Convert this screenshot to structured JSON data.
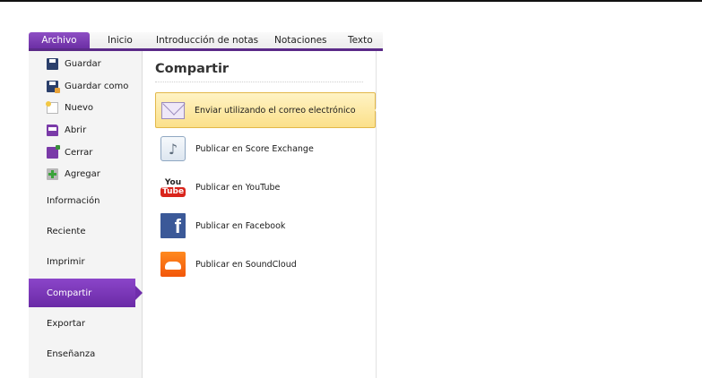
{
  "ribbon": {
    "tabs": [
      {
        "label": "Archivo",
        "active": true
      },
      {
        "label": "Inicio",
        "active": false
      },
      {
        "label": "Introducción de notas",
        "active": false
      },
      {
        "label": "Notaciones",
        "active": false
      },
      {
        "label": "Texto",
        "active": false
      }
    ],
    "accent_color": "#6a2da3"
  },
  "backstage": {
    "commands": [
      {
        "label": "Guardar",
        "icon": "save-icon"
      },
      {
        "label": "Guardar como",
        "icon": "save-as-icon"
      },
      {
        "label": "Nuevo",
        "icon": "new-document-icon"
      },
      {
        "label": "Abrir",
        "icon": "open-folder-icon"
      },
      {
        "label": "Cerrar",
        "icon": "close-folder-icon"
      },
      {
        "label": "Agregar",
        "icon": "add-icon"
      }
    ],
    "sections": [
      {
        "label": "Información"
      },
      {
        "label": "Reciente"
      },
      {
        "label": "Imprimir"
      },
      {
        "label": "Compartir",
        "selected": true
      },
      {
        "label": "Exportar"
      },
      {
        "label": "Enseñanza"
      }
    ]
  },
  "share": {
    "title": "Compartir",
    "options": [
      {
        "label": "Enviar utilizando el correo electrónico",
        "icon": "envelope-icon",
        "selected": true
      },
      {
        "label": "Publicar en Score Exchange",
        "icon": "score-exchange-icon"
      },
      {
        "label": "Publicar en YouTube",
        "icon": "youtube-icon",
        "icon_text": [
          "You",
          "Tube"
        ]
      },
      {
        "label": "Publicar en Facebook",
        "icon": "facebook-icon",
        "icon_text": "f"
      },
      {
        "label": "Publicar en SoundCloud",
        "icon": "soundcloud-icon"
      }
    ],
    "highlight_color": "#fbe08a"
  }
}
